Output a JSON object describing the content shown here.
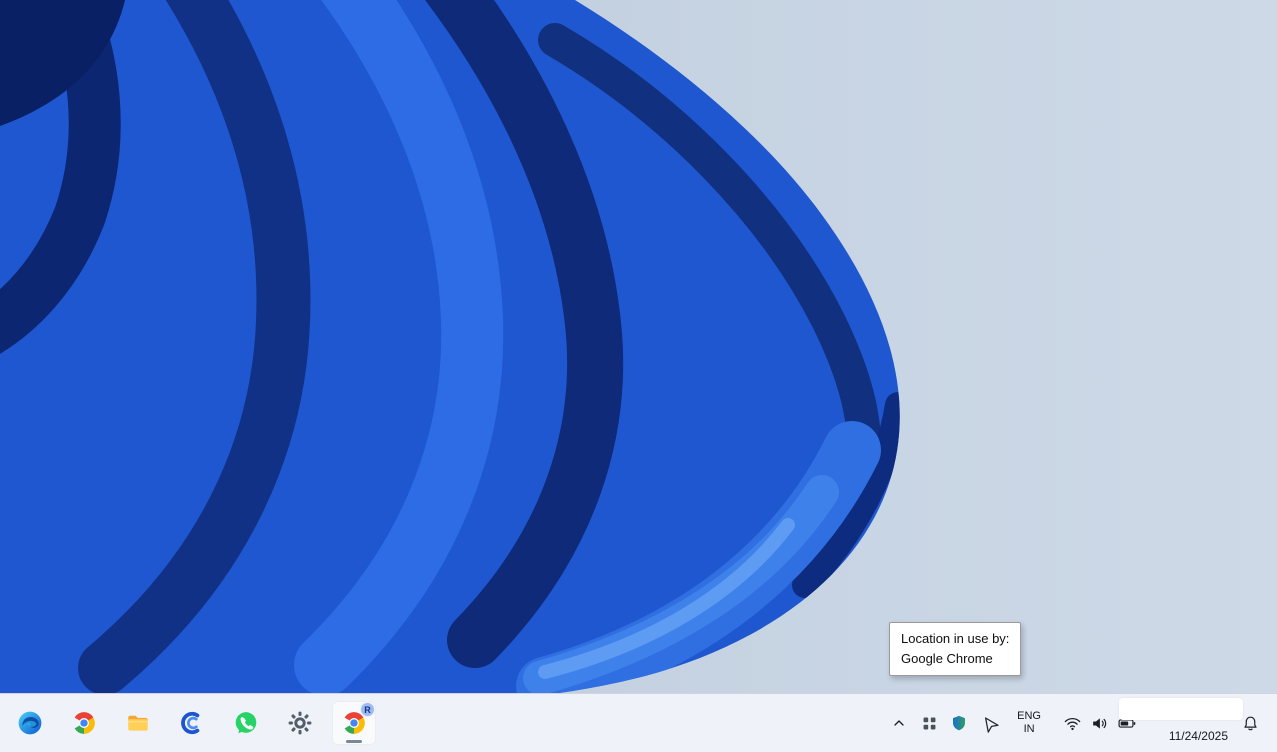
{
  "colors": {
    "taskbar_bg": "#eff3f9",
    "wallpaper_bg_light": "#cdd9e7",
    "bloom_royal_blue": "#1f57d0",
    "bloom_navy": "#0e2a78",
    "bloom_light_blue": "#5e9bf2",
    "tooltip_border": "#9a9a9a"
  },
  "tooltip": {
    "line1": "Location in use by:",
    "line2": "Google Chrome"
  },
  "taskbar": {
    "apps": [
      {
        "icon": "edge-icon"
      },
      {
        "icon": "chrome-icon"
      },
      {
        "icon": "file-explorer-icon"
      },
      {
        "icon": "blue-c-app-icon"
      },
      {
        "icon": "whatsapp-icon"
      },
      {
        "icon": "settings-gear-icon"
      },
      {
        "icon": "chrome-icon",
        "badge": "R",
        "active": true
      }
    ],
    "tray": {
      "icons": [
        "chevron-up-icon",
        "grid-icon",
        "security-shield-icon",
        "location-arrow-icon",
        "wifi-icon",
        "volume-icon",
        "battery-icon",
        "bell-icon"
      ],
      "language": {
        "line1": "ENG",
        "line2": "IN"
      },
      "date": "11/24/2025"
    }
  }
}
